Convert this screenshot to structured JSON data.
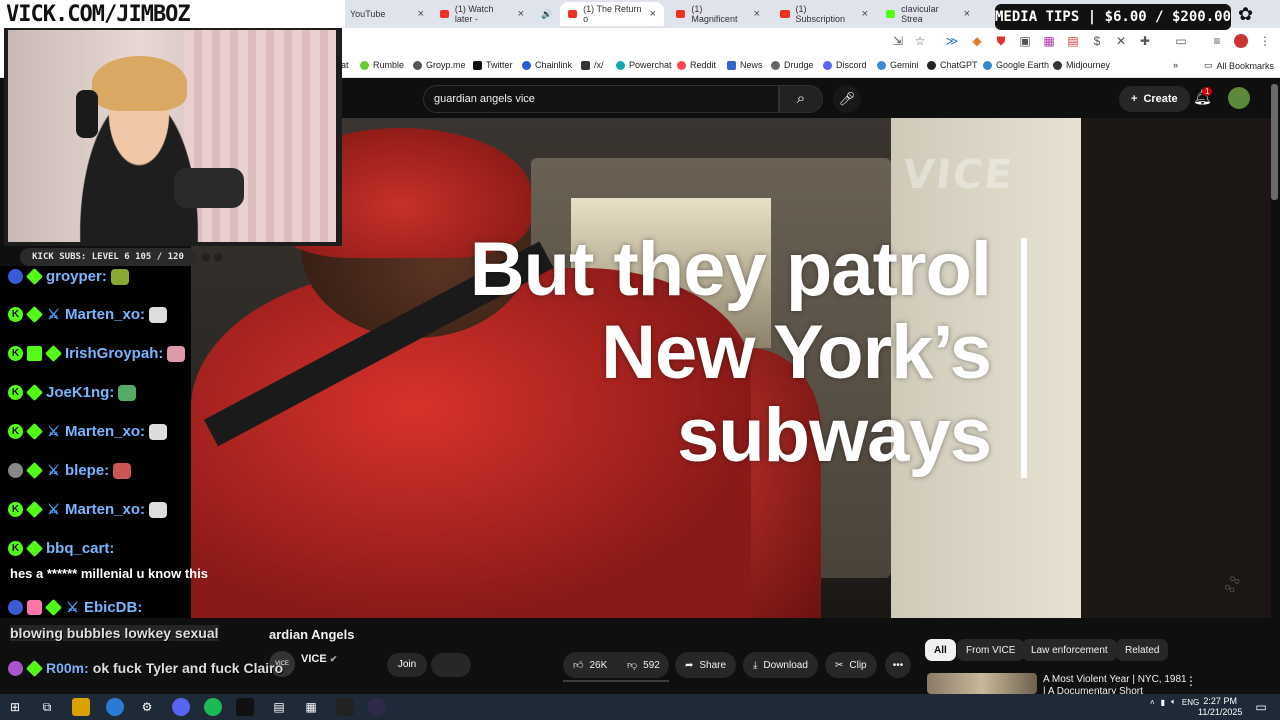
{
  "overlay": {
    "brand": "VICK.COM/JIMBOZ",
    "media_tips": "MEDIA TIPS | $6.00 / $200.00",
    "kick_subs": "KICK SUBS: LEVEL 6 105 / 120"
  },
  "browser": {
    "tabs": [
      {
        "label": "YouTube",
        "active": false
      },
      {
        "label": "(1) Watch later -",
        "active": false
      },
      {
        "label": "(1) The Return o",
        "active": true
      },
      {
        "label": "(1) Magnificent",
        "active": false
      },
      {
        "label": "(1) Subscription",
        "active": false
      },
      {
        "label": "clavicular Strea",
        "active": false
      }
    ],
    "bookmarks": [
      "at",
      "Rumble",
      "Groyp.me",
      "Twitter",
      "Chainlink",
      "/x/",
      "Powerchat",
      "Reddit",
      "News",
      "Drudge",
      "Discord",
      "Gemini",
      "ChatGPT",
      "Google Earth",
      "Midjourney"
    ],
    "all_bookmarks": "All Bookmarks"
  },
  "youtube": {
    "search_value": "guardian angels vice",
    "create_label": "Create",
    "notif_count": "1",
    "video": {
      "watermark": "VICE",
      "caption_lines": [
        "But they patrol",
        "New York’s",
        "subways"
      ],
      "title": "ardian Angels",
      "channel": "VICE",
      "join_label": "Join",
      "likes": "26K",
      "dislikes": "592",
      "share_label": "Share",
      "download_label": "Download",
      "clip_label": "Clip"
    },
    "chips": [
      "All",
      "From VICE",
      "Law enforcement",
      "Related"
    ],
    "related": {
      "title": "A Most Violent Year | NYC, 1981",
      "subtitle": "| A Documentary Short"
    }
  },
  "chat": [
    {
      "user": "groyper:",
      "colors": [
        "#d69",
        "#8a3"
      ]
    },
    {
      "user": "Marten_xo:",
      "colors": [
        "#ddd"
      ]
    },
    {
      "user": "IrishGroypah:",
      "colors": [
        "#d9a"
      ]
    },
    {
      "user": "JoeK1ng:",
      "colors": [
        "#5a6"
      ]
    },
    {
      "user": "Marten_xo:",
      "colors": [
        "#ddd"
      ]
    },
    {
      "user": "blepe:",
      "colors": [
        "#c55"
      ]
    },
    {
      "user": "Marten_xo:",
      "colors": [
        "#ddd"
      ]
    },
    {
      "user": "bbq_cart:",
      "colors": []
    },
    {
      "user": "EbicDB:",
      "colors": []
    }
  ],
  "chat_message": "hes a ****** millenial u know this",
  "overlay_messages": {
    "line1": "blowing bubbles lowkey sexual",
    "user2": "R00m:",
    "line2": "ok fuck Tyler and fuck Clairo"
  },
  "taskbar": {
    "lang": "ENG",
    "time": "2:27 PM",
    "date": "11/21/2025"
  }
}
